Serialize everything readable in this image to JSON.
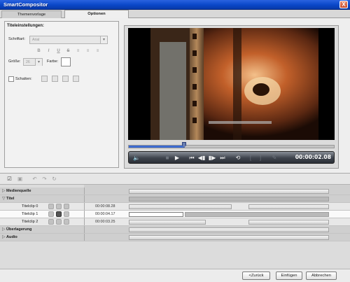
{
  "window": {
    "title": "SmartCompositor",
    "close_glyph": "X"
  },
  "tabs": [
    {
      "label": "Themenvorlage",
      "selected": false
    },
    {
      "label": "Optionen",
      "selected": true
    }
  ],
  "title_settings": {
    "heading": "Titeleinstellungen:",
    "font_label": "Schriftart:",
    "font_value": "Arial",
    "format_buttons": [
      "B",
      "I",
      "U",
      "S",
      "≡",
      "≡",
      "≡"
    ],
    "size_label": "Größe:",
    "size_value": "26",
    "color_label": "Farbe:",
    "color_value": "#ffffff",
    "shadow_label": "Schatten:",
    "shadow_checked": false
  },
  "player": {
    "timecode": "00:00:02.08",
    "progress": 0.27,
    "controls": [
      "volume-icon",
      "stop-icon",
      "play-icon",
      "go-to-start-icon",
      "previous-frame-icon",
      "next-frame-icon",
      "go-to-end-icon",
      "loop-icon",
      "mark-in-icon",
      "mark-out-icon",
      "split-icon"
    ]
  },
  "timeline": {
    "toolbar": [
      "checkmark-icon",
      "delete-icon",
      "undo-icon",
      "redo-icon",
      "redo-all-icon"
    ],
    "rows": [
      {
        "type": "track",
        "name": "Medienquelle",
        "expanded": false
      },
      {
        "type": "track",
        "name": "Titel",
        "expanded": true
      },
      {
        "type": "clip",
        "name": "Titelclip 0",
        "time": "00:00:08.28"
      },
      {
        "type": "clip",
        "name": "Titelclip 1",
        "time": "00:00:04.17",
        "selected": true
      },
      {
        "type": "clip",
        "name": "Titelclip 2",
        "time": "00:00:03.25"
      },
      {
        "type": "track",
        "name": "Überlagerung",
        "expanded": false
      },
      {
        "type": "track",
        "name": "Audio",
        "expanded": false
      }
    ]
  },
  "buttons": {
    "back": "<Zurück",
    "insert": "Einfügen",
    "cancel": "Abbrechen"
  }
}
